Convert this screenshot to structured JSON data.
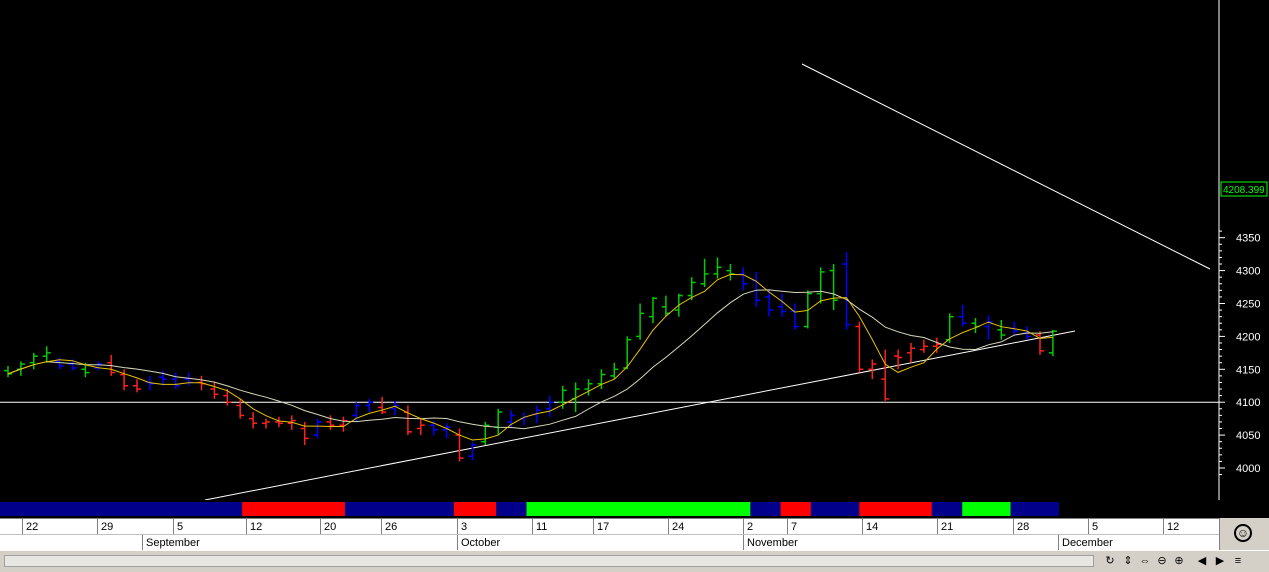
{
  "chart_data": {
    "type": "ohlc",
    "ylim": [
      3980,
      4360
    ],
    "yticks": [
      4000,
      4050,
      4100,
      4150,
      4200,
      4250,
      4300,
      4350
    ],
    "last_price_label": "4208.399",
    "bars": [
      {
        "o": 4148,
        "h": 4155,
        "l": 4138,
        "c": 4143,
        "color": "green"
      },
      {
        "o": 4150,
        "h": 4162,
        "l": 4140,
        "c": 4158,
        "color": "green"
      },
      {
        "o": 4160,
        "h": 4175,
        "l": 4150,
        "c": 4170,
        "color": "green"
      },
      {
        "o": 4170,
        "h": 4185,
        "l": 4160,
        "c": 4175,
        "color": "green"
      },
      {
        "o": 4162,
        "h": 4168,
        "l": 4150,
        "c": 4155,
        "color": "blue"
      },
      {
        "o": 4158,
        "h": 4165,
        "l": 4148,
        "c": 4152,
        "color": "blue"
      },
      {
        "o": 4150,
        "h": 4160,
        "l": 4138,
        "c": 4145,
        "color": "green"
      },
      {
        "o": 4152,
        "h": 4162,
        "l": 4148,
        "c": 4158,
        "color": "blue"
      },
      {
        "o": 4160,
        "h": 4172,
        "l": 4140,
        "c": 4145,
        "color": "red"
      },
      {
        "o": 4142,
        "h": 4150,
        "l": 4118,
        "c": 4125,
        "color": "red"
      },
      {
        "o": 4125,
        "h": 4135,
        "l": 4115,
        "c": 4120,
        "color": "red"
      },
      {
        "o": 4130,
        "h": 4140,
        "l": 4118,
        "c": 4128,
        "color": "blue"
      },
      {
        "o": 4138,
        "h": 4148,
        "l": 4125,
        "c": 4135,
        "color": "blue"
      },
      {
        "o": 4135,
        "h": 4145,
        "l": 4120,
        "c": 4125,
        "color": "blue"
      },
      {
        "o": 4135,
        "h": 4145,
        "l": 4125,
        "c": 4130,
        "color": "blue"
      },
      {
        "o": 4130,
        "h": 4140,
        "l": 4118,
        "c": 4128,
        "color": "red"
      },
      {
        "o": 4120,
        "h": 4130,
        "l": 4105,
        "c": 4112,
        "color": "red"
      },
      {
        "o": 4110,
        "h": 4120,
        "l": 4095,
        "c": 4100,
        "color": "red"
      },
      {
        "o": 4095,
        "h": 4105,
        "l": 4075,
        "c": 4080,
        "color": "red"
      },
      {
        "o": 4075,
        "h": 4085,
        "l": 4060,
        "c": 4068,
        "color": "red"
      },
      {
        "o": 4068,
        "h": 4075,
        "l": 4060,
        "c": 4070,
        "color": "red"
      },
      {
        "o": 4070,
        "h": 4078,
        "l": 4062,
        "c": 4068,
        "color": "red"
      },
      {
        "o": 4068,
        "h": 4080,
        "l": 4058,
        "c": 4072,
        "color": "red"
      },
      {
        "o": 4060,
        "h": 4070,
        "l": 4035,
        "c": 4045,
        "color": "red"
      },
      {
        "o": 4050,
        "h": 4075,
        "l": 4045,
        "c": 4070,
        "color": "blue"
      },
      {
        "o": 4070,
        "h": 4080,
        "l": 4058,
        "c": 4065,
        "color": "red"
      },
      {
        "o": 4065,
        "h": 4078,
        "l": 4055,
        "c": 4072,
        "color": "red"
      },
      {
        "o": 4080,
        "h": 4100,
        "l": 4070,
        "c": 4095,
        "color": "blue"
      },
      {
        "o": 4095,
        "h": 4105,
        "l": 4085,
        "c": 4100,
        "color": "blue"
      },
      {
        "o": 4092,
        "h": 4108,
        "l": 4082,
        "c": 4085,
        "color": "red"
      },
      {
        "o": 4090,
        "h": 4102,
        "l": 4080,
        "c": 4095,
        "color": "blue"
      },
      {
        "o": 4085,
        "h": 4095,
        "l": 4050,
        "c": 4055,
        "color": "red"
      },
      {
        "o": 4060,
        "h": 4075,
        "l": 4050,
        "c": 4065,
        "color": "red"
      },
      {
        "o": 4065,
        "h": 4072,
        "l": 4050,
        "c": 4058,
        "color": "blue"
      },
      {
        "o": 4058,
        "h": 4068,
        "l": 4045,
        "c": 4062,
        "color": "blue"
      },
      {
        "o": 4050,
        "h": 4060,
        "l": 4010,
        "c": 4015,
        "color": "red"
      },
      {
        "o": 4018,
        "h": 4040,
        "l": 4012,
        "c": 4035,
        "color": "blue"
      },
      {
        "o": 4040,
        "h": 4070,
        "l": 4035,
        "c": 4065,
        "color": "green"
      },
      {
        "o": 4062,
        "h": 4090,
        "l": 4050,
        "c": 4085,
        "color": "green"
      },
      {
        "o": 4070,
        "h": 4088,
        "l": 4062,
        "c": 4080,
        "color": "blue"
      },
      {
        "o": 4075,
        "h": 4085,
        "l": 4065,
        "c": 4078,
        "color": "blue"
      },
      {
        "o": 4082,
        "h": 4095,
        "l": 4068,
        "c": 4088,
        "color": "blue"
      },
      {
        "o": 4090,
        "h": 4110,
        "l": 4078,
        "c": 4100,
        "color": "blue"
      },
      {
        "o": 4100,
        "h": 4125,
        "l": 4090,
        "c": 4118,
        "color": "green"
      },
      {
        "o": 4105,
        "h": 4130,
        "l": 4085,
        "c": 4120,
        "color": "green"
      },
      {
        "o": 4120,
        "h": 4135,
        "l": 4110,
        "c": 4128,
        "color": "green"
      },
      {
        "o": 4128,
        "h": 4150,
        "l": 4120,
        "c": 4142,
        "color": "green"
      },
      {
        "o": 4140,
        "h": 4160,
        "l": 4135,
        "c": 4150,
        "color": "green"
      },
      {
        "o": 4152,
        "h": 4200,
        "l": 4150,
        "c": 4195,
        "color": "green"
      },
      {
        "o": 4200,
        "h": 4250,
        "l": 4195,
        "c": 4235,
        "color": "green"
      },
      {
        "o": 4230,
        "h": 4260,
        "l": 4220,
        "c": 4258,
        "color": "green"
      },
      {
        "o": 4245,
        "h": 4262,
        "l": 4230,
        "c": 4235,
        "color": "green"
      },
      {
        "o": 4240,
        "h": 4265,
        "l": 4230,
        "c": 4262,
        "color": "green"
      },
      {
        "o": 4262,
        "h": 4290,
        "l": 4255,
        "c": 4282,
        "color": "green"
      },
      {
        "o": 4280,
        "h": 4318,
        "l": 4275,
        "c": 4295,
        "color": "green"
      },
      {
        "o": 4295,
        "h": 4320,
        "l": 4288,
        "c": 4305,
        "color": "green"
      },
      {
        "o": 4300,
        "h": 4310,
        "l": 4285,
        "c": 4295,
        "color": "green"
      },
      {
        "o": 4295,
        "h": 4305,
        "l": 4270,
        "c": 4280,
        "color": "blue"
      },
      {
        "o": 4285,
        "h": 4298,
        "l": 4245,
        "c": 4255,
        "color": "blue"
      },
      {
        "o": 4260,
        "h": 4272,
        "l": 4230,
        "c": 4240,
        "color": "blue"
      },
      {
        "o": 4245,
        "h": 4265,
        "l": 4230,
        "c": 4238,
        "color": "blue"
      },
      {
        "o": 4238,
        "h": 4250,
        "l": 4210,
        "c": 4215,
        "color": "blue"
      },
      {
        "o": 4215,
        "h": 4270,
        "l": 4212,
        "c": 4265,
        "color": "green"
      },
      {
        "o": 4265,
        "h": 4305,
        "l": 4250,
        "c": 4298,
        "color": "green"
      },
      {
        "o": 4300,
        "h": 4310,
        "l": 4240,
        "c": 4255,
        "color": "green"
      },
      {
        "o": 4310,
        "h": 4328,
        "l": 4210,
        "c": 4218,
        "color": "blue"
      },
      {
        "o": 4215,
        "h": 4222,
        "l": 4145,
        "c": 4150,
        "color": "red"
      },
      {
        "o": 4150,
        "h": 4165,
        "l": 4135,
        "c": 4158,
        "color": "red"
      },
      {
        "o": 4135,
        "h": 4180,
        "l": 4102,
        "c": 4105,
        "color": "red"
      },
      {
        "o": 4170,
        "h": 4180,
        "l": 4150,
        "c": 4168,
        "color": "red"
      },
      {
        "o": 4175,
        "h": 4190,
        "l": 4160,
        "c": 4182,
        "color": "red"
      },
      {
        "o": 4180,
        "h": 4195,
        "l": 4175,
        "c": 4185,
        "color": "red"
      },
      {
        "o": 4185,
        "h": 4198,
        "l": 4175,
        "c": 4188,
        "color": "red"
      },
      {
        "o": 4195,
        "h": 4235,
        "l": 4190,
        "c": 4230,
        "color": "green"
      },
      {
        "o": 4230,
        "h": 4248,
        "l": 4215,
        "c": 4220,
        "color": "blue"
      },
      {
        "o": 4220,
        "h": 4228,
        "l": 4205,
        "c": 4215,
        "color": "green"
      },
      {
        "o": 4215,
        "h": 4232,
        "l": 4195,
        "c": 4222,
        "color": "blue"
      },
      {
        "o": 4210,
        "h": 4225,
        "l": 4195,
        "c": 4202,
        "color": "green"
      },
      {
        "o": 4212,
        "h": 4222,
        "l": 4200,
        "c": 4208,
        "color": "blue"
      },
      {
        "o": 4205,
        "h": 4215,
        "l": 4195,
        "c": 4200,
        "color": "blue"
      },
      {
        "o": 4202,
        "h": 4208,
        "l": 4172,
        "c": 4178,
        "color": "red"
      },
      {
        "o": 4175,
        "h": 4210,
        "l": 4170,
        "c": 4208,
        "color": "green"
      }
    ],
    "band_segments": [
      {
        "color": "#00008b",
        "start": 0,
        "end": 40
      },
      {
        "color": "#ff0000",
        "start": 40,
        "end": 57
      },
      {
        "color": "#00008b",
        "start": 57,
        "end": 75
      },
      {
        "color": "#ff0000",
        "start": 75,
        "end": 82
      },
      {
        "color": "#00008b",
        "start": 82,
        "end": 87
      },
      {
        "color": "#00ff00",
        "start": 87,
        "end": 124
      },
      {
        "color": "#00008b",
        "start": 124,
        "end": 129
      },
      {
        "color": "#ff0000",
        "start": 129,
        "end": 134
      },
      {
        "color": "#00008b",
        "start": 134,
        "end": 142
      },
      {
        "color": "#ff0000",
        "start": 142,
        "end": 154
      },
      {
        "color": "#00008b",
        "start": 154,
        "end": 159
      },
      {
        "color": "#00ff00",
        "start": 159,
        "end": 167
      },
      {
        "color": "#00008b",
        "start": 167,
        "end": 175
      }
    ],
    "day_ticks": [
      "22",
      "29",
      "5",
      "12",
      "20",
      "26",
      "3",
      "11",
      "17",
      "24",
      "2",
      "7",
      "14",
      "21",
      "28",
      "5",
      "12"
    ],
    "months": [
      "September",
      "October",
      "November",
      "December"
    ]
  },
  "colors": {
    "up": "#00cc00",
    "down": "#ff2020",
    "neutral": "#0000ff",
    "fast_ma": "#e8c200",
    "slow_ma": "#d8d8b8",
    "lines": "#ffffff",
    "axis": "#ffffff"
  },
  "icons": [
    "refresh-icon",
    "move-vertical-icon",
    "move-horizontal-icon",
    "zoom-out-icon",
    "zoom-in-icon",
    "arrow-left-icon",
    "arrow-right-icon",
    "menu-icon",
    "smiley-icon"
  ]
}
